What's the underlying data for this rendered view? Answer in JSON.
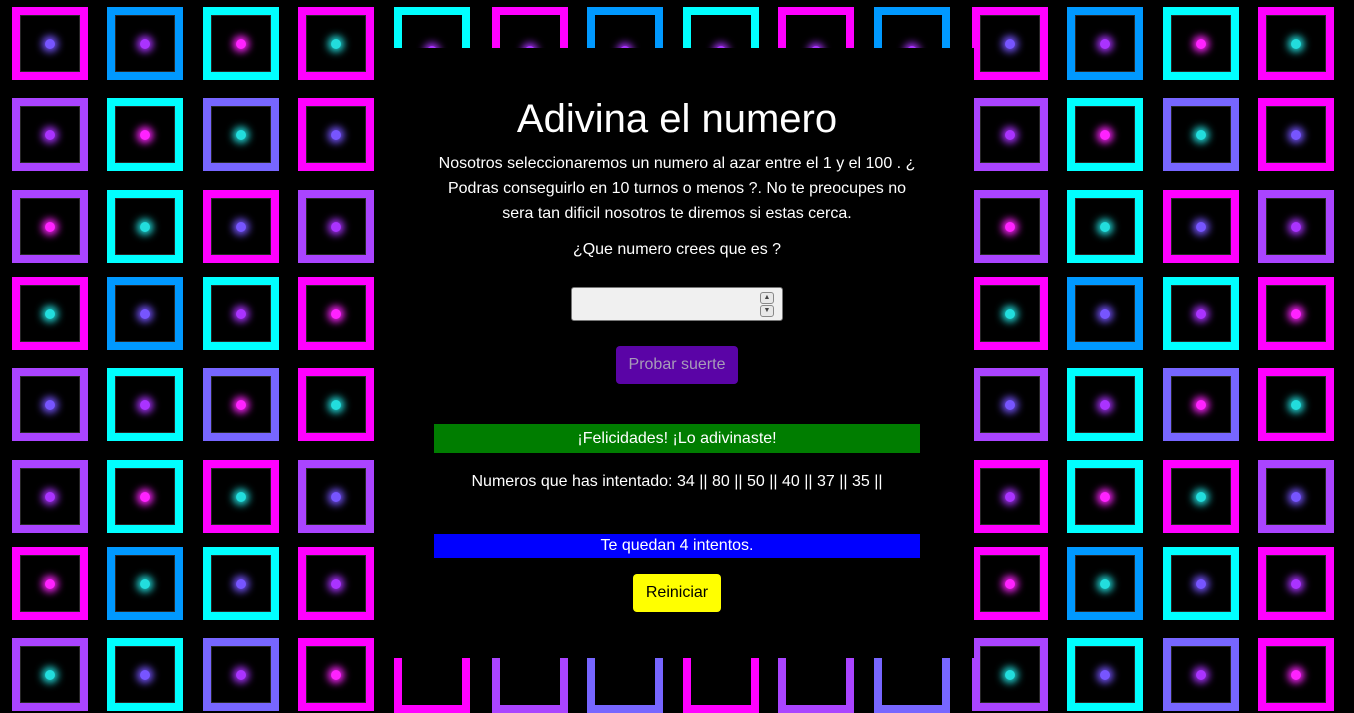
{
  "title": "Adivina el numero",
  "description": "Nosotros seleccionaremos un numero al azar entre el 1 y el 100 . ¿ Podras conseguirlo en 10 turnos o menos ?. No te preocupes no sera tan dificil nosotros te diremos si estas cerca.",
  "prompt": "¿Que numero crees que es ?",
  "guess_input": {
    "value": "",
    "placeholder": ""
  },
  "submit_label": "Probar suerte",
  "result_message": "¡Felicidades! ¡Lo adivinaste!",
  "tried_label": "Numeros que has intentado: 34 || 80 || 50 || 40 || 37 || 35 ||",
  "remaining_message": "Te quedan 4 intentos.",
  "restart_label": "Reiniciar",
  "colors": {
    "background": "#000000",
    "tile_palette": [
      "#ff00ff",
      "#0099ff",
      "#00ffff",
      "#aa44ff",
      "#7766ff"
    ],
    "submit_button": "#5a04a6",
    "result_bar": "#007d00",
    "remaining_bar": "#0000ff",
    "restart_button": "#ffff00"
  }
}
